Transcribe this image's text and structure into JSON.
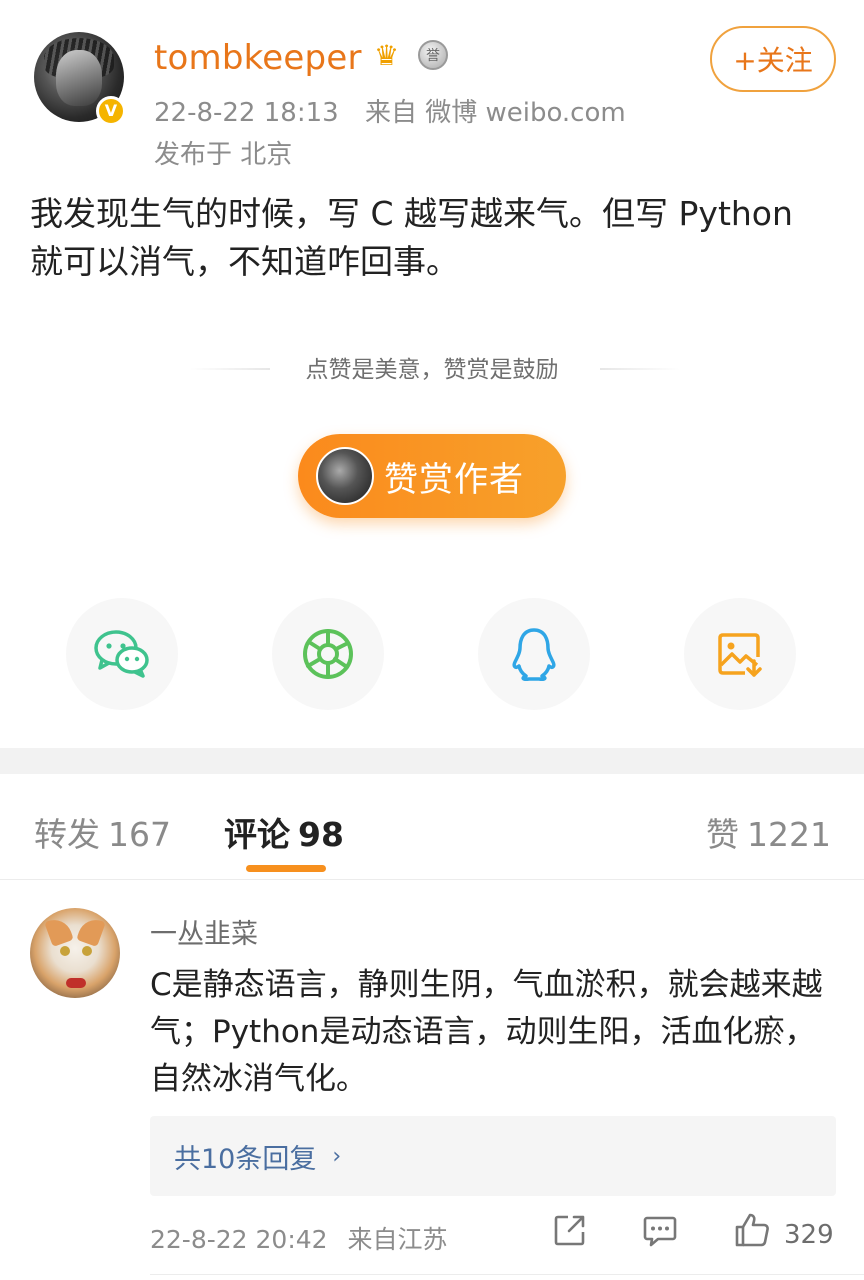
{
  "post": {
    "username": "tombkeeper",
    "time": "22-8-22 18:13",
    "source": "来自 微博 weibo.com",
    "location": "发布于 北京",
    "follow_label": "+关注",
    "body": "我发现生气的时候，写 C 越写越来气。但写 Python 就可以消气，不知道咋回事。",
    "reward_slogan": "点赞是美意，赞赏是鼓励",
    "reward_button": "赞赏作者",
    "share": [
      {
        "icon": "wechat-icon",
        "color": "#3fc38e"
      },
      {
        "icon": "moments-icon",
        "color": "#5cc25a"
      },
      {
        "icon": "qq-icon",
        "color": "#2fa6e6"
      },
      {
        "icon": "save-image-icon",
        "color": "#f6a31e"
      }
    ]
  },
  "tabs": {
    "repost_label": "转发",
    "repost_count": "167",
    "comment_label": "评论",
    "comment_count": "98",
    "like_label": "赞",
    "like_count": "1221"
  },
  "comment": {
    "name": "一丛韭菜",
    "text": "C是静态语言，静则生阴，气血淤积，就会越来越气；Python是动态语言，动则生阳，活血化瘀，自然冰消气化。",
    "replies_label": "共10条回复",
    "time": "22-8-22 20:42",
    "source": "来自江苏",
    "like_count": "329"
  },
  "colors": {
    "brand_orange": "#e8761a",
    "reward_gradient_start": "#fb8a1c",
    "reward_gradient_end": "#f7a12b",
    "link_blue": "#4a6ea0"
  }
}
